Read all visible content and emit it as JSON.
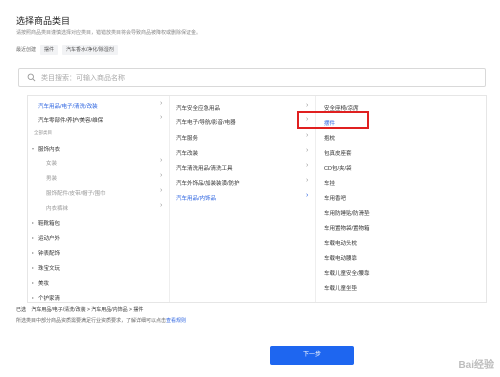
{
  "page": {
    "title": "选择商品类目",
    "subtitle": "请按照商品类目谨慎选择对应类目，错错放类目将会导致商品被降权或删除保证金。",
    "recent_label": "最近创建",
    "recent_chips": [
      "摆件",
      "汽车香水/净化/除湿剂"
    ]
  },
  "search": {
    "placeholder": "类目搜索：可输入商品名称"
  },
  "column1": {
    "items": [
      {
        "label": "汽车用品/电子/清洗/改装",
        "selected": true
      },
      {
        "label": "汽车零部件/养护/美容/维保"
      },
      {
        "label": "全部类目",
        "header": true
      },
      {
        "label": "服饰内衣",
        "expandable": true
      },
      {
        "label": "女装",
        "sub": true
      },
      {
        "label": "男装",
        "sub": true
      },
      {
        "label": "服饰配件/皮带/帽子/围巾",
        "sub": true
      },
      {
        "label": "内衣裤袜",
        "sub": true
      },
      {
        "label": "鞋靴箱包",
        "expandable": true
      },
      {
        "label": "运动户外",
        "expandable": true
      },
      {
        "label": "钟表配饰",
        "expandable": true
      },
      {
        "label": "珠宝文玩",
        "expandable": true
      },
      {
        "label": "美妆",
        "expandable": true
      },
      {
        "label": "个护家清",
        "expandable": true
      }
    ]
  },
  "column2": {
    "items": [
      {
        "label": "汽车安全应急用品"
      },
      {
        "label": "汽车电子/导航/影音/电器"
      },
      {
        "label": "汽车服务"
      },
      {
        "label": "汽车改装"
      },
      {
        "label": "汽车清洗用品/清洗工具"
      },
      {
        "label": "汽车外饰品/加装装潢/防护"
      },
      {
        "label": "汽车用品/内饰品",
        "selected": true
      }
    ]
  },
  "column3": {
    "items": [
      {
        "label": "安全座椅/凉席"
      },
      {
        "label": "摆件",
        "selected": true
      },
      {
        "label": "抱枕"
      },
      {
        "label": "包真皮座套"
      },
      {
        "label": "CD包/夹/袋"
      },
      {
        "label": "车挂"
      },
      {
        "label": "车用香吧"
      },
      {
        "label": "车用防睡贴/防滑垫"
      },
      {
        "label": "车用置物袋/置物箱"
      },
      {
        "label": "车载电动头枕"
      },
      {
        "label": "车载电动腰靠"
      },
      {
        "label": "车载儿童安全/腰靠"
      },
      {
        "label": "车载儿童坐垫"
      }
    ]
  },
  "footer": {
    "selected_prefix": "已选",
    "selected_path": "汽车用品/电子/清洗/改装 > 汽车用品/内饰品 > 摆件",
    "notice_text": "所选类目中部分商品资质需要满足行业资质要求，了解详细可以点击",
    "notice_link": "查看规则",
    "next_button": "下一步"
  },
  "watermark": "Bai经验",
  "colors": {
    "accent": "#1e66f0",
    "selection": "#2b63e0",
    "highlight_box": "#e02020"
  }
}
